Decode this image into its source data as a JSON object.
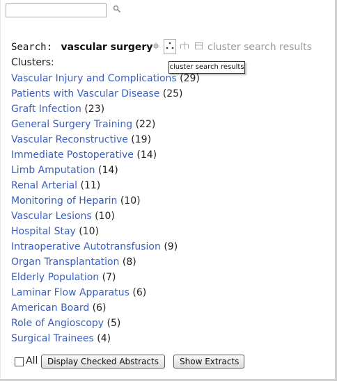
{
  "search_input": {
    "value": ""
  },
  "search": {
    "label": "Search:",
    "query": "vascular surgery",
    "results_link": "cluster search results",
    "tooltip": "cluster search results"
  },
  "icons": [
    "search-go-icon",
    "move-icon",
    "dots-icon",
    "tree-icon",
    "window-icon"
  ],
  "clusters_label": "Clusters:",
  "clusters": [
    {
      "label": "Vascular Injury and Complications",
      "count": "(29)"
    },
    {
      "label": "Patients with Vascular Disease",
      "count": "(25)"
    },
    {
      "label": "Graft Infection",
      "count": "(23)"
    },
    {
      "label": "General Surgery Training",
      "count": "(22)"
    },
    {
      "label": "Vascular Reconstructive",
      "count": "(19)"
    },
    {
      "label": "Immediate Postoperative",
      "count": "(14)"
    },
    {
      "label": "Limb Amputation",
      "count": "(14)"
    },
    {
      "label": "Renal Arterial",
      "count": "(11)"
    },
    {
      "label": "Monitoring of Heparin",
      "count": "(10)"
    },
    {
      "label": "Vascular Lesions",
      "count": "(10)"
    },
    {
      "label": "Hospital Stay",
      "count": "(10)"
    },
    {
      "label": "Intraoperative Autotransfusion",
      "count": "(9)"
    },
    {
      "label": "Organ Transplantation",
      "count": "(8)"
    },
    {
      "label": "Elderly Population",
      "count": "(7)"
    },
    {
      "label": "Laminar Flow Apparatus",
      "count": "(6)"
    },
    {
      "label": "American Board",
      "count": "(6)"
    },
    {
      "label": "Role of Angioscopy",
      "count": "(5)"
    },
    {
      "label": "Surgical Trainees",
      "count": "(4)"
    }
  ],
  "bottom": {
    "all_label": "All",
    "display_button": "Display Checked Abstracts",
    "extracts_button": "Show Extracts"
  },
  "colors": {
    "link": "#3b5fbf",
    "muted": "#9a9a9a"
  }
}
